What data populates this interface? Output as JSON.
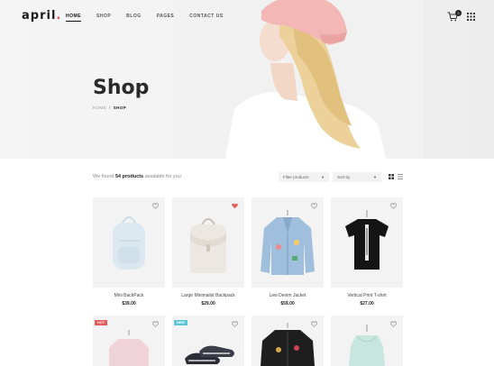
{
  "brand": {
    "name": "april",
    "dot": ".",
    "accent": "#e25b5b"
  },
  "nav": {
    "items": [
      {
        "label": "HOME",
        "active": true
      },
      {
        "label": "SHOP"
      },
      {
        "label": "BLOG"
      },
      {
        "label": "PAGES"
      },
      {
        "label": "CONTACT US"
      }
    ],
    "cart_count": "2"
  },
  "hero": {
    "title": "Shop",
    "breadcrumb": {
      "home": "HOME",
      "sep": "/",
      "current": "SHOP"
    }
  },
  "toolbar": {
    "found_prefix": "We found",
    "found_count": "54 products",
    "found_suffix": "available for you",
    "filter_label": "Filter products",
    "sort_label": "Sort by"
  },
  "products": [
    {
      "name": "Mini BackPack",
      "price": "$39.00",
      "wishlisted": false
    },
    {
      "name": "Large Minimalist Backpack",
      "price": "$29.00",
      "wishlisted": true
    },
    {
      "name": "Lew Denim Jacket",
      "price": "$59.00",
      "wishlisted": false
    },
    {
      "name": "Vertical Print T-shirt",
      "price": "$27.00",
      "wishlisted": false
    },
    {
      "name": "",
      "price": "",
      "badge": "HOT",
      "badge_color": "#e25b5b"
    },
    {
      "name": "",
      "price": "",
      "badge": "NEW",
      "badge_color": "#5bc7d6"
    },
    {
      "name": "",
      "price": ""
    },
    {
      "name": "",
      "price": ""
    }
  ]
}
